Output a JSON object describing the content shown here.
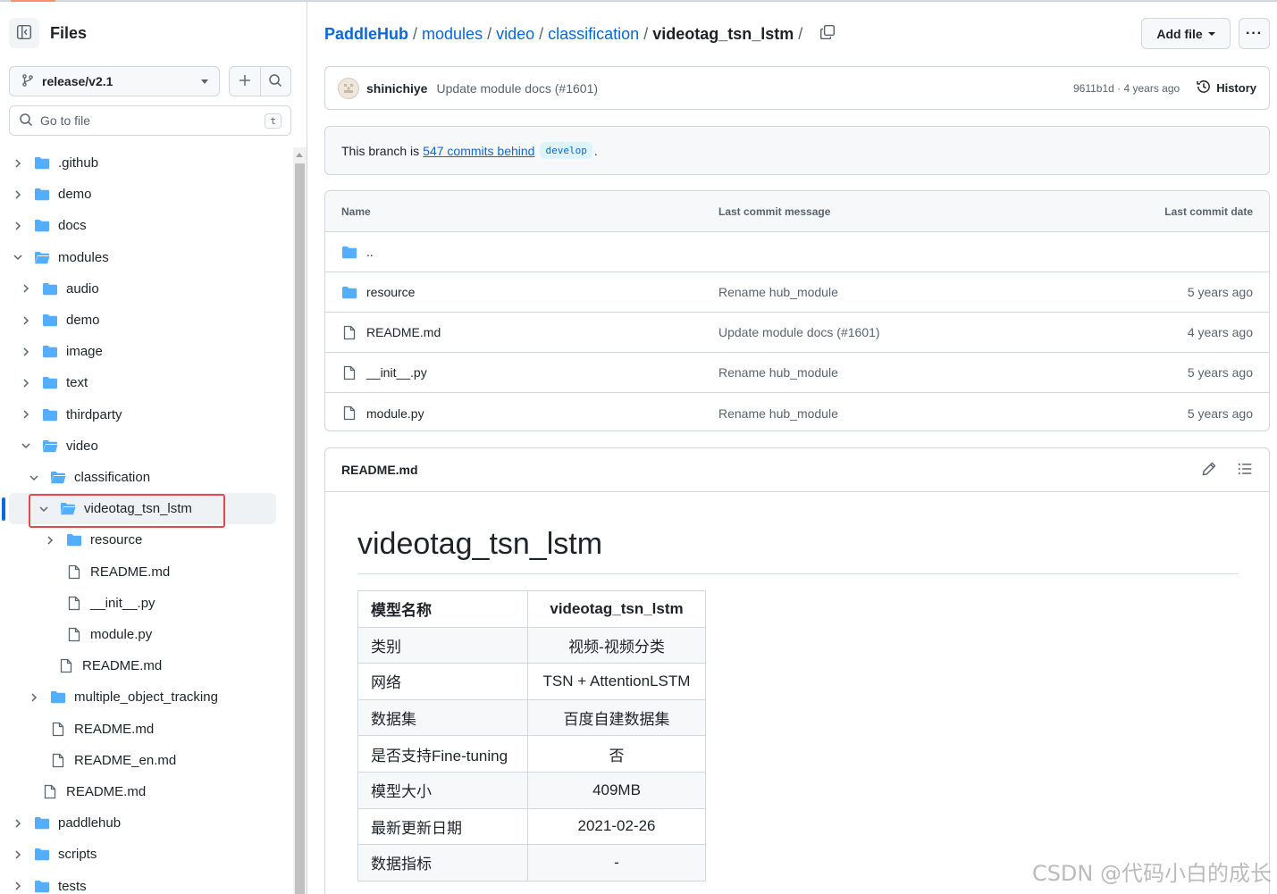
{
  "sidebar": {
    "title": "Files",
    "branch": "release/v2.1",
    "search_placeholder": "Go to file",
    "search_shortcut": "t",
    "tree": [
      {
        "label": ".github",
        "type": "folder",
        "depth": 0,
        "expanded": false
      },
      {
        "label": "demo",
        "type": "folder",
        "depth": 0,
        "expanded": false
      },
      {
        "label": "docs",
        "type": "folder",
        "depth": 0,
        "expanded": false
      },
      {
        "label": "modules",
        "type": "folder",
        "depth": 0,
        "expanded": true
      },
      {
        "label": "audio",
        "type": "folder",
        "depth": 1,
        "expanded": false
      },
      {
        "label": "demo",
        "type": "folder",
        "depth": 1,
        "expanded": false
      },
      {
        "label": "image",
        "type": "folder",
        "depth": 1,
        "expanded": false
      },
      {
        "label": "text",
        "type": "folder",
        "depth": 1,
        "expanded": false
      },
      {
        "label": "thirdparty",
        "type": "folder",
        "depth": 1,
        "expanded": false
      },
      {
        "label": "video",
        "type": "folder",
        "depth": 1,
        "expanded": true
      },
      {
        "label": "classification",
        "type": "folder",
        "depth": 2,
        "expanded": true
      },
      {
        "label": "videotag_tsn_lstm",
        "type": "folder",
        "depth": 3,
        "expanded": true,
        "selected": true
      },
      {
        "label": "resource",
        "type": "folder",
        "depth": 4,
        "expanded": false
      },
      {
        "label": "README.md",
        "type": "file",
        "depth": 4
      },
      {
        "label": "__init__.py",
        "type": "file",
        "depth": 4
      },
      {
        "label": "module.py",
        "type": "file",
        "depth": 4
      },
      {
        "label": "README.md",
        "type": "file",
        "depth": 3
      },
      {
        "label": "multiple_object_tracking",
        "type": "folder",
        "depth": 2,
        "expanded": false
      },
      {
        "label": "README.md",
        "type": "file",
        "depth": 2
      },
      {
        "label": "README_en.md",
        "type": "file",
        "depth": 2
      },
      {
        "label": "README.md",
        "type": "file",
        "depth": 1
      },
      {
        "label": "paddlehub",
        "type": "folder",
        "depth": 0,
        "expanded": false
      },
      {
        "label": "scripts",
        "type": "folder",
        "depth": 0,
        "expanded": false
      },
      {
        "label": "tests",
        "type": "folder",
        "depth": 0,
        "expanded": false
      }
    ]
  },
  "breadcrumb": {
    "repo": "PaddleHub",
    "parts": [
      "modules",
      "video",
      "classification"
    ],
    "current": "videotag_tsn_lstm",
    "trailing": "/"
  },
  "toolbar": {
    "add_file": "Add file",
    "more": "···"
  },
  "commit": {
    "author": "shinichiye",
    "message": "Update module docs (#1601)",
    "meta": "9611b1d · 4 years ago",
    "history": "History"
  },
  "branch_note": {
    "prefix": "This branch is",
    "link": "547 commits behind",
    "branch": "develop",
    "suffix": "."
  },
  "files": {
    "headers": {
      "name": "Name",
      "message": "Last commit message",
      "date": "Last commit date"
    },
    "rows": [
      {
        "name": "..",
        "type": "folder",
        "message": "",
        "date": ""
      },
      {
        "name": "resource",
        "type": "folder",
        "message": "Rename hub_module",
        "date": "5 years ago"
      },
      {
        "name": "README.md",
        "type": "file",
        "message": "Update module docs (#1601)",
        "date": "4 years ago"
      },
      {
        "name": "__init__.py",
        "type": "file",
        "message": "Rename hub_module",
        "date": "5 years ago"
      },
      {
        "name": "module.py",
        "type": "file",
        "message": "Rename hub_module",
        "date": "5 years ago"
      }
    ]
  },
  "readme": {
    "filename": "README.md",
    "heading": "videotag_tsn_lstm",
    "table": [
      [
        "模型名称",
        "videotag_tsn_lstm"
      ],
      [
        "类别",
        "视频-视频分类"
      ],
      [
        "网络",
        "TSN + AttentionLSTM"
      ],
      [
        "数据集",
        "百度自建数据集"
      ],
      [
        "是否支持Fine-tuning",
        "否"
      ],
      [
        "模型大小",
        "409MB"
      ],
      [
        "最新更新日期",
        "2021-02-26"
      ],
      [
        "数据指标",
        "-"
      ]
    ]
  },
  "watermark": "CSDN @代码小白的成长",
  "colors": {
    "accent": "#0969da",
    "folder": "#54aeff",
    "highlight_box": "#e5484d"
  }
}
